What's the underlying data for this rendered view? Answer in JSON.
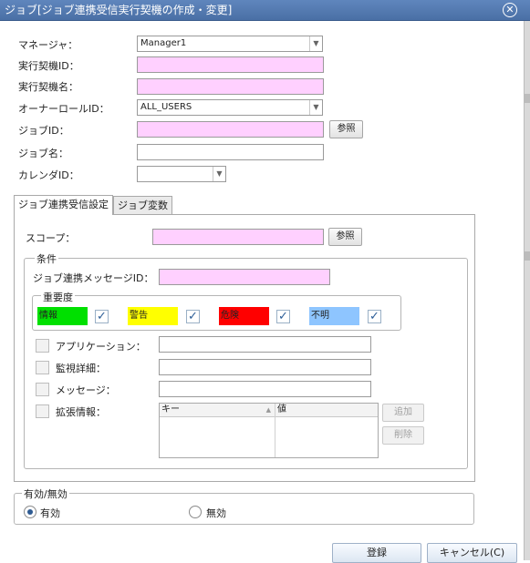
{
  "window": {
    "title": "ジョブ[ジョブ連携受信実行契機の作成・変更]"
  },
  "form": {
    "manager_label": "マネージャ：",
    "manager_value": "Manager1",
    "trigger_id_label": "実行契機ID：",
    "trigger_id_value": "",
    "trigger_name_label": "実行契機名：",
    "trigger_name_value": "",
    "owner_role_label": "オーナーロールID：",
    "owner_role_value": "ALL_USERS",
    "job_id_label": "ジョブID：",
    "job_id_value": "",
    "ref_button": "参照",
    "job_name_label": "ジョブ名：",
    "job_name_value": "",
    "calendar_label": "カレンダID：",
    "calendar_value": ""
  },
  "tabs": [
    {
      "label": "ジョブ連携受信設定",
      "active": true
    },
    {
      "label": "ジョブ変数",
      "active": false
    }
  ],
  "receive": {
    "scope_label": "スコープ：",
    "scope_value": "",
    "ref_button": "参照",
    "conditions_title": "条件",
    "message_id_label": "ジョブ連携メッセージID：",
    "message_id_value": "",
    "severity_title": "重要度",
    "severities": [
      {
        "label": "情報",
        "color": "#00e000",
        "checked": true
      },
      {
        "label": "警告",
        "color": "#ffff00",
        "checked": true
      },
      {
        "label": "危険",
        "color": "#ff0000",
        "checked": true
      },
      {
        "label": "不明",
        "color": "#8ec5ff",
        "checked": true
      }
    ],
    "application_label": "アプリケーション：",
    "application_value": "",
    "monitor_detail_label": "監視詳細：",
    "monitor_detail_value": "",
    "message_label": "メッセージ：",
    "message_value": "",
    "ext_info_label": "拡張情報：",
    "ext_table": {
      "col_key": "キー",
      "col_value": "値"
    },
    "add_button": "追加",
    "delete_button": "削除"
  },
  "validity": {
    "title": "有効/無効",
    "enabled_label": "有効",
    "disabled_label": "無効",
    "selected": "有効"
  },
  "footer": {
    "register_button": "登録",
    "cancel_button": "キャンセル(C)"
  }
}
